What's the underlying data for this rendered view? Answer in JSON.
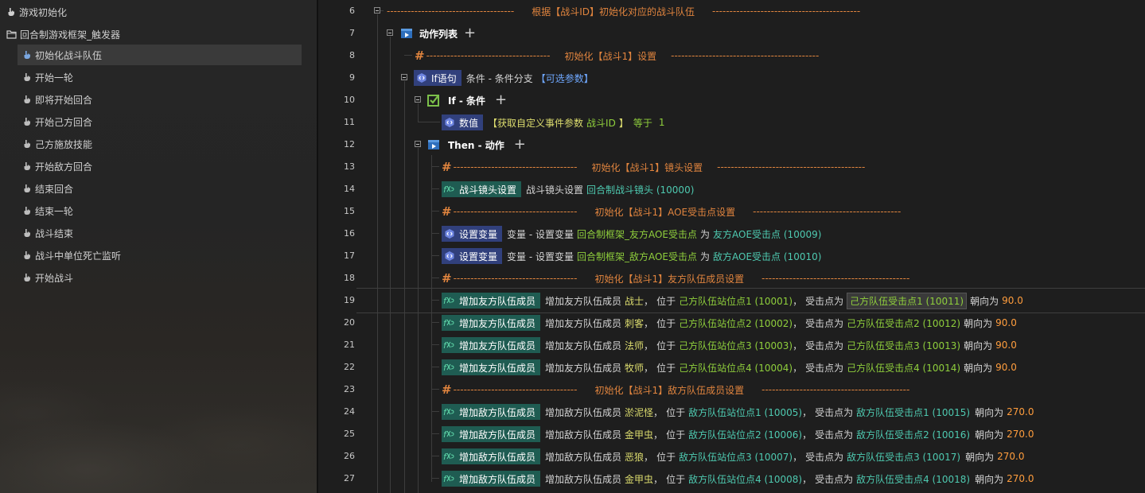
{
  "left_tree": {
    "items": [
      {
        "label": "游戏初始化"
      },
      {
        "label": "回合制游戏框架_触发器"
      },
      {
        "label": "初始化战斗队伍"
      },
      {
        "label": "开始一轮"
      },
      {
        "label": "即将开始回合"
      },
      {
        "label": "开始己方回合"
      },
      {
        "label": "己方施放技能"
      },
      {
        "label": "开始敌方回合"
      },
      {
        "label": "结束回合"
      },
      {
        "label": "结束一轮"
      },
      {
        "label": "战斗结束"
      },
      {
        "label": "战斗中单位死亡监听"
      },
      {
        "label": "开始战斗"
      }
    ]
  },
  "editor": {
    "line_numbers": [
      "6",
      "7",
      "8",
      "9",
      "10",
      "11",
      "12",
      "13",
      "14",
      "15",
      "16",
      "17",
      "18",
      "19",
      "20",
      "21",
      "22",
      "23",
      "24",
      "25",
      "26",
      "27"
    ],
    "l6": {
      "left_dashes": "-------------------------------------",
      "title": "根据【战斗ID】初始化对应的战斗队伍",
      "right_dashes": "-------------------------------------------"
    },
    "l7": {
      "label": "动作列表",
      "plus": "+"
    },
    "l8": {
      "hash": "#",
      "left_dashes": "------------------------------------",
      "title": "初始化【战斗1】设置",
      "right_dashes": "-------------------------------------------"
    },
    "l9": {
      "tag": "If语句",
      "desc": "条件 - 条件分支",
      "optional": "【可选参数】"
    },
    "l10": {
      "label": "If - 条件",
      "plus": "+"
    },
    "l11": {
      "tag": "数值",
      "p1": "【获取自定义事件参数",
      "param": "战斗ID",
      "p2": "】",
      "op": "等于",
      "val": "1"
    },
    "l12": {
      "label": "Then - 动作",
      "plus": "+"
    },
    "l13": {
      "hash": "#",
      "left_dashes": "------------------------------------",
      "title": "初始化【战斗1】镜头设置",
      "right_dashes": "-------------------------------------------"
    },
    "l14": {
      "tag": "战斗镜头设置",
      "desc": "战斗镜头设置",
      "arg": "回合制战斗镜头 (10000)"
    },
    "l15": {
      "hash": "#",
      "left_dashes": "------------------------------------",
      "title": "初始化【战斗1】AOE受击点设置",
      "right_dashes": "-------------------------------------------"
    },
    "l16": {
      "tag": "设置变量",
      "desc": "变量 - 设置变量",
      "var": "回合制框架_友方AOE受击点",
      "as": "为",
      "val": "友方AOE受击点 (10009)"
    },
    "l17": {
      "tag": "设置变量",
      "desc": "变量 - 设置变量",
      "var": "回合制框架_敌方AOE受击点",
      "as": "为",
      "val": "敌方AOE受击点 (10010)"
    },
    "l18": {
      "hash": "#",
      "left_dashes": "------------------------------------",
      "title": "初始化【战斗1】友方队伍成员设置",
      "right_dashes": "-------------------------------------------"
    },
    "ally_rows": [
      {
        "tag": "增加友方队伍成员",
        "desc": "增加友方队伍成员",
        "unit": "战士",
        "pos": "己方队伍站位点1 (10001)",
        "hit": "己方队伍受击点1 (10011)",
        "face": "90.0"
      },
      {
        "tag": "增加友方队伍成员",
        "desc": "增加友方队伍成员",
        "unit": "刺客",
        "pos": "己方队伍站位点2 (10002)",
        "hit": "己方队伍受击点2 (10012)",
        "face": "90.0"
      },
      {
        "tag": "增加友方队伍成员",
        "desc": "增加友方队伍成员",
        "unit": "法师",
        "pos": "己方队伍站位点3 (10003)",
        "hit": "己方队伍受击点3 (10013)",
        "face": "90.0"
      },
      {
        "tag": "增加友方队伍成员",
        "desc": "增加友方队伍成员",
        "unit": "牧师",
        "pos": "己方队伍站位点4 (10004)",
        "hit": "己方队伍受击点4 (10014)",
        "face": "90.0"
      }
    ],
    "l23": {
      "hash": "#",
      "left_dashes": "------------------------------------",
      "title": "初始化【战斗1】敌方队伍成员设置",
      "right_dashes": "-------------------------------------------"
    },
    "enemy_rows": [
      {
        "tag": "增加敌方队伍成员",
        "desc": "增加敌方队伍成员",
        "unit": "淤泥怪",
        "pos": "敌方队伍站位点1 (10005)",
        "hit": "敌方队伍受击点1 (10015)",
        "face": "270.0"
      },
      {
        "tag": "增加敌方队伍成员",
        "desc": "增加敌方队伍成员",
        "unit": "金甲虫",
        "pos": "敌方队伍站位点2 (10006)",
        "hit": "敌方队伍受击点2 (10016)",
        "face": "270.0"
      },
      {
        "tag": "增加敌方队伍成员",
        "desc": "增加敌方队伍成员",
        "unit": "恶狼",
        "pos": "敌方队伍站位点3 (10007)",
        "hit": "敌方队伍受击点3 (10017)",
        "face": "270.0"
      },
      {
        "tag": "增加敌方队伍成员",
        "desc": "增加敌方队伍成员",
        "unit": "金甲虫",
        "pos": "敌方队伍站位点4 (10008)",
        "hit": "敌方队伍受击点4 (10018)",
        "face": "270.0"
      }
    ],
    "words": {
      "comma": "，",
      "at": "位于",
      "hit_at": "受击点为",
      "facing": "朝向为"
    }
  },
  "colors": {
    "accent_orange": "#e0843e",
    "func_tag": "#1f5c52",
    "blue_tag": "#31407c",
    "value_green": "#8fcf3c",
    "value_cyan": "#4ec9b0"
  }
}
